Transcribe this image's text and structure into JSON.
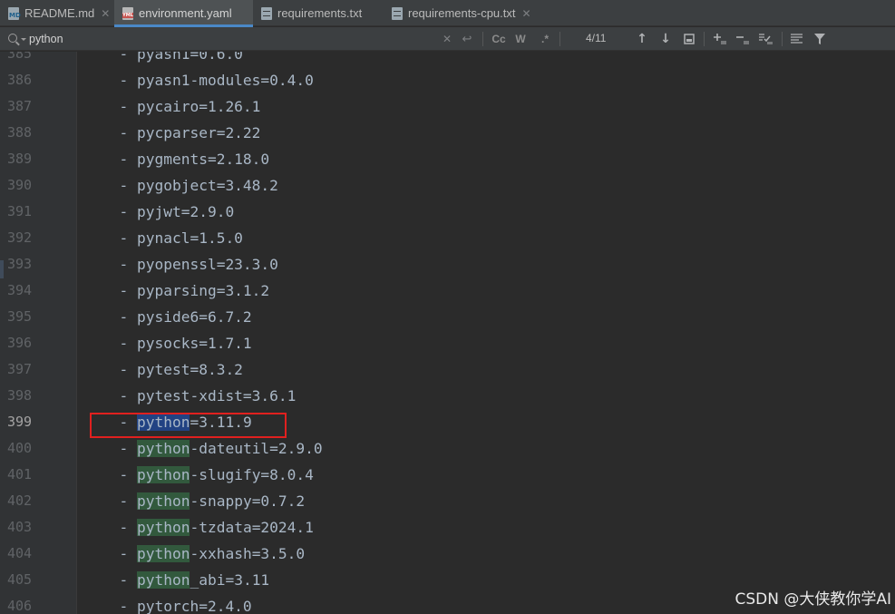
{
  "tabs": [
    {
      "label": "README.md",
      "icon": "markdown-file-icon",
      "icon_text": "MD"
    },
    {
      "label": "environment.yaml",
      "icon": "yaml-file-icon",
      "icon_text": "YML",
      "active": true
    },
    {
      "label": "requirements.txt",
      "icon": "text-file-icon"
    },
    {
      "label": "requirements-cpu.txt",
      "icon": "text-file-icon"
    }
  ],
  "tab_close_glyph": "✕",
  "search": {
    "query": "python",
    "match_counter": "4/11",
    "match_case_label": "Cc",
    "words_label": "W",
    "regex_label": ".*",
    "clear_glyph": "✕",
    "up_glyph": "↑",
    "down_glyph": "↓"
  },
  "editor": {
    "lines": [
      {
        "num": "385",
        "prefix": "  - ",
        "term": "",
        "rest": "pyasn1=0.6.0"
      },
      {
        "num": "386",
        "prefix": "  - ",
        "term": "",
        "rest": "pyasn1-modules=0.4.0"
      },
      {
        "num": "387",
        "prefix": "  - ",
        "term": "",
        "rest": "pycairo=1.26.1"
      },
      {
        "num": "388",
        "prefix": "  - ",
        "term": "",
        "rest": "pycparser=2.22"
      },
      {
        "num": "389",
        "prefix": "  - ",
        "term": "",
        "rest": "pygments=2.18.0"
      },
      {
        "num": "390",
        "prefix": "  - ",
        "term": "",
        "rest": "pygobject=3.48.2"
      },
      {
        "num": "391",
        "prefix": "  - ",
        "term": "",
        "rest": "pyjwt=2.9.0"
      },
      {
        "num": "392",
        "prefix": "  - ",
        "term": "",
        "rest": "pynacl=1.5.0"
      },
      {
        "num": "393",
        "prefix": "  - ",
        "term": "",
        "rest": "pyopenssl=23.3.0"
      },
      {
        "num": "394",
        "prefix": "  - ",
        "term": "",
        "rest": "pyparsing=3.1.2"
      },
      {
        "num": "395",
        "prefix": "  - ",
        "term": "",
        "rest": "pyside6=6.7.2"
      },
      {
        "num": "396",
        "prefix": "  - ",
        "term": "",
        "rest": "pysocks=1.7.1"
      },
      {
        "num": "397",
        "prefix": "  - ",
        "term": "",
        "rest": "pytest=8.3.2"
      },
      {
        "num": "398",
        "prefix": "  - ",
        "term": "",
        "rest": "pytest-xdist=3.6.1"
      },
      {
        "num": "399",
        "prefix": "  - ",
        "term": "python",
        "rest": "=3.11.9",
        "selected": true
      },
      {
        "num": "400",
        "prefix": "  - ",
        "term": "python",
        "rest": "-dateutil=2.9.0"
      },
      {
        "num": "401",
        "prefix": "  - ",
        "term": "python",
        "rest": "-slugify=8.0.4"
      },
      {
        "num": "402",
        "prefix": "  - ",
        "term": "python",
        "rest": "-snappy=0.7.2"
      },
      {
        "num": "403",
        "prefix": "  - ",
        "term": "python",
        "rest": "-tzdata=2024.1"
      },
      {
        "num": "404",
        "prefix": "  - ",
        "term": "python",
        "rest": "-xxhash=3.5.0"
      },
      {
        "num": "405",
        "prefix": "  - ",
        "term": "python",
        "rest": "_abi=3.11"
      },
      {
        "num": "406",
        "prefix": "  - ",
        "term": "",
        "rest": "pytorch=2.4.0"
      }
    ]
  },
  "watermark": "CSDN @大侠教你学AI",
  "colors": {
    "editor_bg": "#2b2b2b",
    "match_highlight": "#32593d",
    "current_match": "#214283",
    "annotation_box": "#e0201f",
    "active_tab_underline": "#4a88c7"
  }
}
